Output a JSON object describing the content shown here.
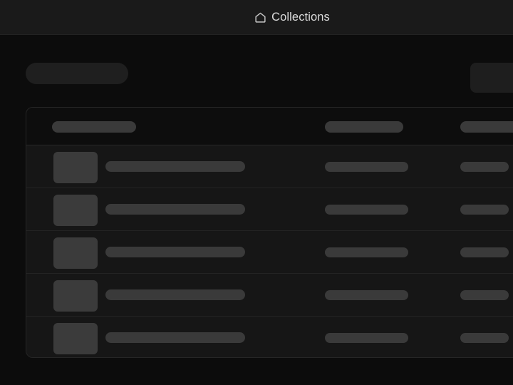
{
  "window": {
    "title": "Collections"
  },
  "topbar": {
    "icon": "home-icon",
    "title": "Collections"
  },
  "toolbar": {
    "title_placeholder_label": "",
    "action_placeholder_label": "",
    "state": "loading"
  },
  "table": {
    "loading": true,
    "header": {
      "columns": [
        "",
        "",
        ""
      ]
    },
    "rows": [
      {
        "thumbnail": "",
        "name": "",
        "col2": "",
        "col3": ""
      },
      {
        "thumbnail": "",
        "name": "",
        "col2": "",
        "col3": ""
      },
      {
        "thumbnail": "",
        "name": "",
        "col2": "",
        "col3": ""
      },
      {
        "thumbnail": "",
        "name": "",
        "col2": "",
        "col3": ""
      },
      {
        "thumbnail": "",
        "name": "",
        "col2": "",
        "col3": ""
      }
    ]
  },
  "colors": {
    "page_background": "#0c0c0c",
    "topbar_background": "#1a1a1a",
    "card_background": "#111111",
    "row_background": "#161616",
    "card_border": "#262626",
    "row_divider": "#232323",
    "skeleton": "#3a3a3a",
    "skeleton_dim": "#1f1f1f",
    "text": "#dcdcdc"
  }
}
